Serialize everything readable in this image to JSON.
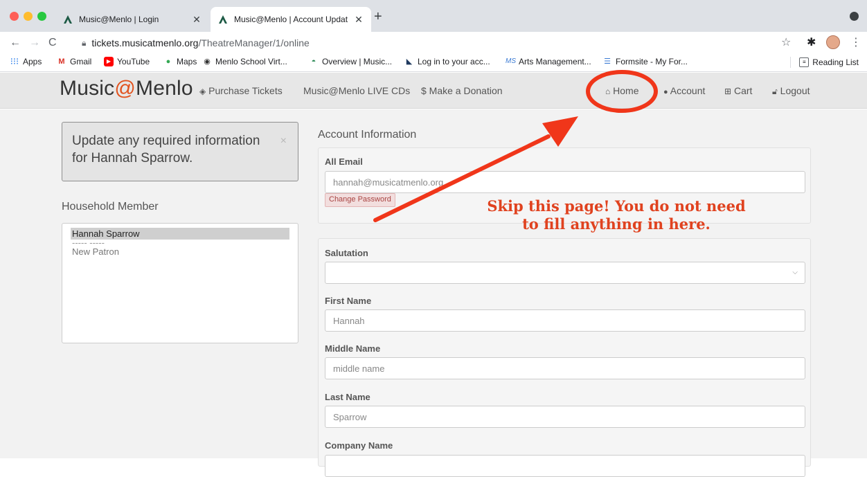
{
  "browser": {
    "tabs": [
      {
        "title": "Music@Menlo | Login",
        "active": false
      },
      {
        "title": "Music@Menlo | Account Updat",
        "active": true
      }
    ],
    "new_tab": "+",
    "url_host": "tickets.musicatmenlo.org",
    "url_path": "/TheatreManager/1/online",
    "bookmarks": [
      {
        "label": "Apps",
        "icon": "apps-grid-icon"
      },
      {
        "label": "Gmail",
        "icon": "gmail-icon"
      },
      {
        "label": "YouTube",
        "icon": "youtube-icon"
      },
      {
        "label": "Maps",
        "icon": "maps-icon"
      },
      {
        "label": "Menlo School Virt...",
        "icon": "globe-icon"
      },
      {
        "label": "Overview | Music...",
        "icon": "overview-icon"
      },
      {
        "label": "Log in to your acc...",
        "icon": "envelope-icon"
      },
      {
        "label": "Arts Management...",
        "icon": "arts-icon"
      },
      {
        "label": "Formsite - My For...",
        "icon": "formsite-icon"
      }
    ],
    "reading_list": "Reading List"
  },
  "site": {
    "brand_prefix": "Music",
    "brand_at": "@",
    "brand_suffix": "Menlo",
    "nav": {
      "purchase": "Purchase Tickets",
      "cds": "Music@Menlo LIVE CDs",
      "donation": "$ Make a Donation",
      "home": "Home",
      "account": "Account",
      "cart": "Cart",
      "logout": "Logout"
    }
  },
  "page": {
    "alert_text": "Update any required information for Hannah Sparrow.",
    "alert_close": "×",
    "household_heading": "Household Member",
    "household_members": {
      "selected": "Hannah Sparrow",
      "separator": "----- -----",
      "new_patron": "New Patron"
    },
    "account_heading": "Account Information",
    "email_label": "All Email",
    "email_value": "hannah@musicatmenlo.org",
    "change_password": "Change Password",
    "fields": {
      "salutation_label": "Salutation",
      "salutation_value": "",
      "first_name_label": "First Name",
      "first_name_value": "Hannah",
      "middle_name_label": "Middle Name",
      "middle_name_placeholder": "middle name",
      "last_name_label": "Last Name",
      "last_name_value": "Sparrow",
      "company_label": "Company Name"
    }
  },
  "annotation": {
    "note": "Skip this page! You do not need to fill anything in here.",
    "color": "#e0421f"
  }
}
